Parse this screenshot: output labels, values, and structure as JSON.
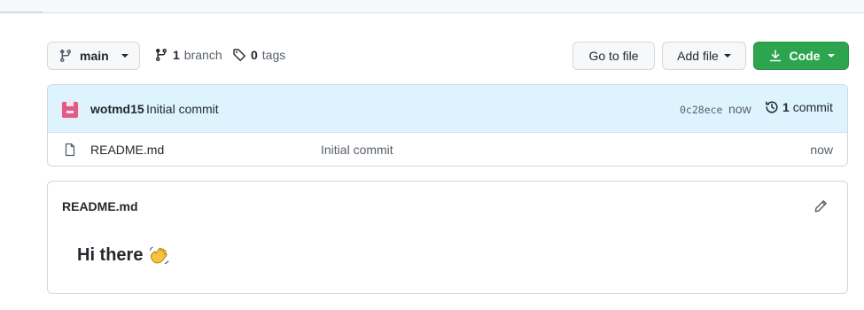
{
  "toolbar": {
    "branch_name": "main",
    "branch_count": "1",
    "branch_label": "branch",
    "tag_count": "0",
    "tag_label": "tags",
    "goto_file_label": "Go to file",
    "add_file_label": "Add file",
    "code_label": "Code"
  },
  "latest_commit": {
    "author": "wotmd15",
    "message": "Initial commit",
    "sha": "0c28ece",
    "time": "now",
    "commit_count": "1",
    "commit_label": "commit"
  },
  "files": [
    {
      "name": "README.md",
      "last_commit": "Initial commit",
      "time": "now",
      "icon": "file-icon"
    }
  ],
  "readme": {
    "title": "README.md",
    "heading": "Hi there",
    "heading_emoji": "waving-hand"
  },
  "colors": {
    "code_button": "#2da44e",
    "commit_bar": "#ddf4ff",
    "avatar": "#e05a8a"
  }
}
